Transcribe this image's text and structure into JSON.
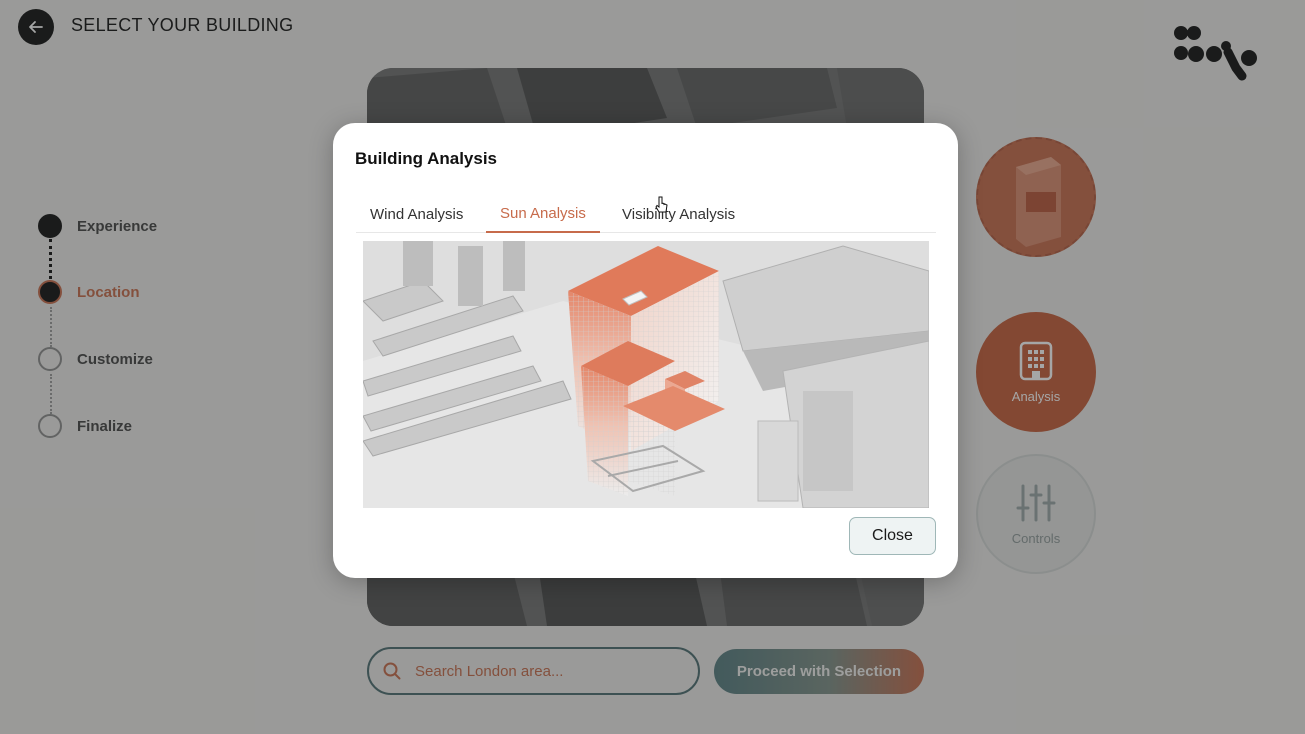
{
  "header": {
    "title": "SELECT YOUR BUILDING"
  },
  "stepper": {
    "steps": [
      {
        "label": "Experience",
        "state": "done"
      },
      {
        "label": "Location",
        "state": "active"
      },
      {
        "label": "Customize",
        "state": "pending"
      },
      {
        "label": "Finalize",
        "state": "pending"
      }
    ]
  },
  "tools": {
    "analysis_label": "Analysis",
    "controls_label": "Controls"
  },
  "search": {
    "placeholder": "Search London area..."
  },
  "actions": {
    "proceed_label": "Proceed with Selection"
  },
  "modal": {
    "title": "Building Analysis",
    "tabs": [
      {
        "label": "Wind Analysis",
        "active": false
      },
      {
        "label": "Sun Analysis",
        "active": true
      },
      {
        "label": "Visibility Analysis",
        "active": false
      }
    ],
    "close_label": "Close"
  },
  "colors": {
    "accent": "#c76b4b",
    "analysis_button": "#c45d3a",
    "teal_border": "#4d6d70",
    "dark": "#111111"
  },
  "icons": {
    "back": "arrow-left-icon",
    "brand": "brand-logo",
    "analysis": "building-icon",
    "controls": "sliders-icon",
    "search": "search-icon"
  }
}
